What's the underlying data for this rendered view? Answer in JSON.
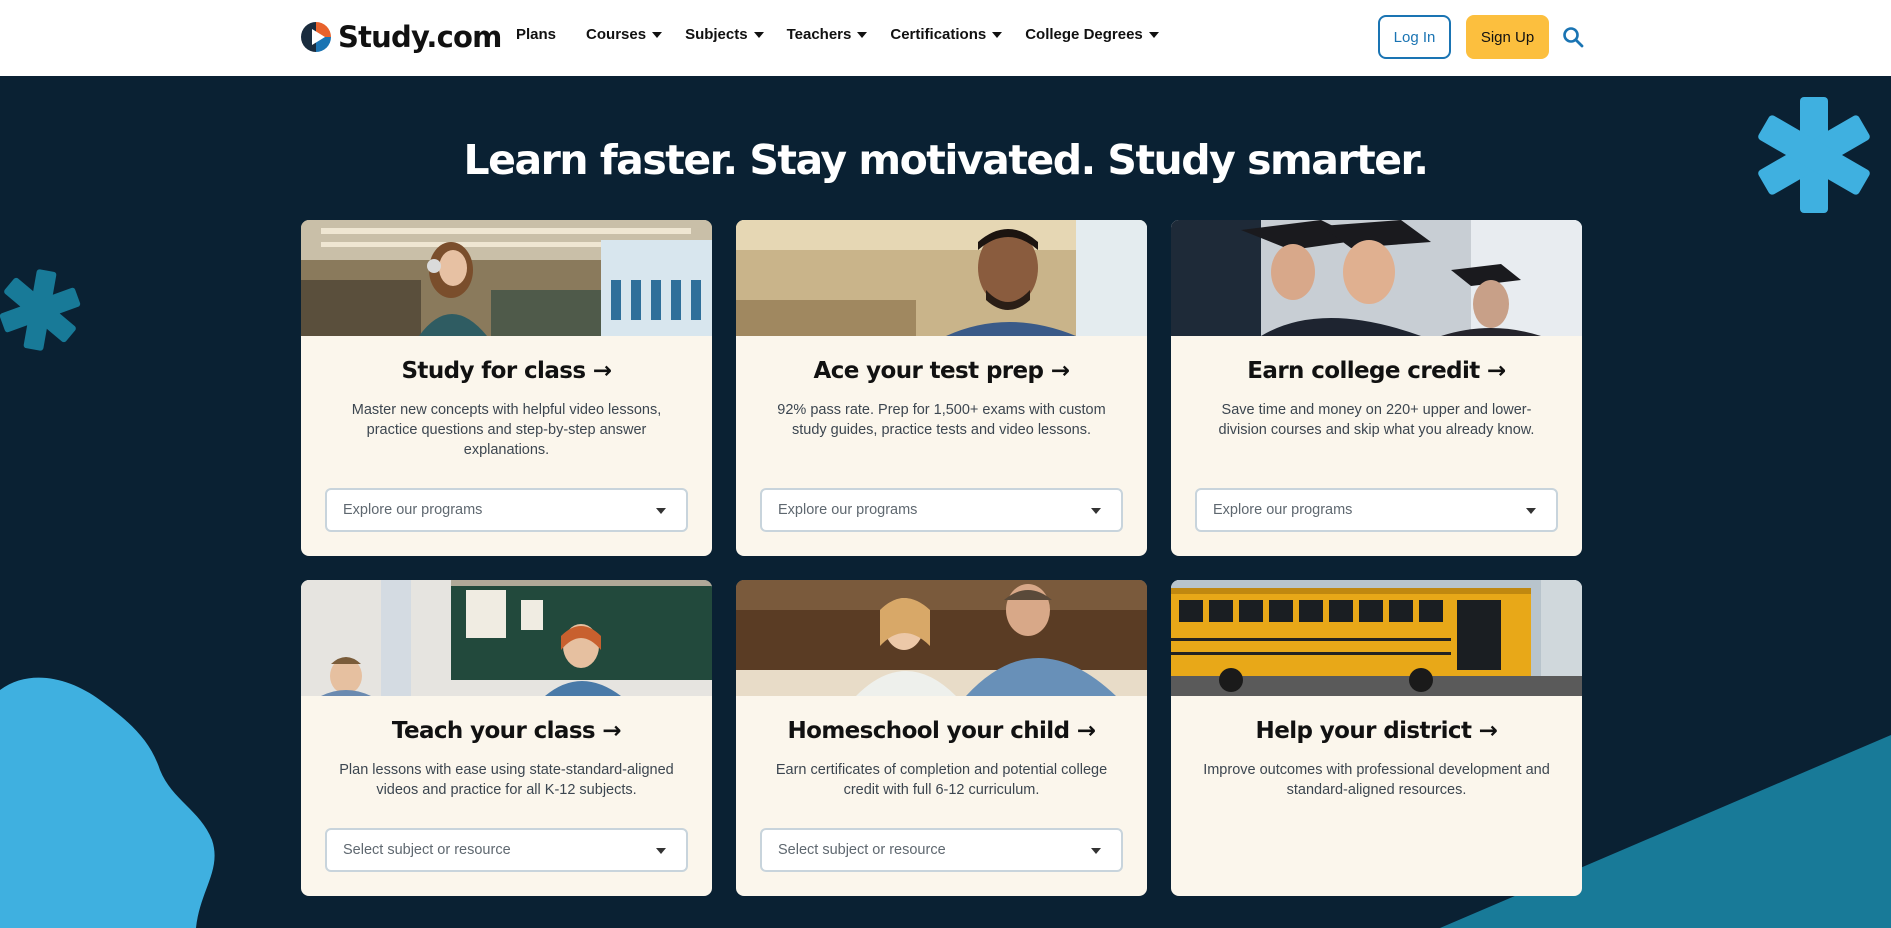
{
  "brand": {
    "name": "Study.com"
  },
  "nav": {
    "items": [
      {
        "label": "Plans",
        "has_dropdown": false
      },
      {
        "label": "Courses",
        "has_dropdown": true
      },
      {
        "label": "Subjects",
        "has_dropdown": true
      },
      {
        "label": "Teachers",
        "has_dropdown": true
      },
      {
        "label": "Certifications",
        "has_dropdown": true
      },
      {
        "label": "College Degrees",
        "has_dropdown": true
      }
    ],
    "login_label": "Log In",
    "signup_label": "Sign Up",
    "search_icon": "search-icon"
  },
  "hero": {
    "headline": "Learn faster. Stay motivated. Study smarter."
  },
  "cards": [
    {
      "title": "Study for class →",
      "description": "Master new concepts with helpful video lessons, practice questions and step-by-step answer explanations.",
      "select_placeholder": "Explore our programs"
    },
    {
      "title": "Ace your test prep →",
      "description": "92% pass rate. Prep for 1,500+ exams with custom study guides, practice tests and video lessons.",
      "select_placeholder": "Explore our programs"
    },
    {
      "title": "Earn college credit →",
      "description": "Save time and money on 220+ upper and lower-division courses and skip what you already know.",
      "select_placeholder": "Explore our programs"
    },
    {
      "title": "Teach your class →",
      "description": "Plan lessons with ease using state-standard-aligned videos and practice for all K-12 subjects.",
      "select_placeholder": "Select subject or resource"
    },
    {
      "title": "Homeschool your child →",
      "description": "Earn certificates of completion and potential college credit with full 6-12 curriculum.",
      "select_placeholder": "Select subject or resource"
    },
    {
      "title": "Help your district →",
      "description": "Improve outcomes with professional development and standard-aligned resources."
    }
  ],
  "colors": {
    "background": "#0a2133",
    "accent_blue": "#1a74b3",
    "signup_yellow": "#fcbf3e",
    "card_bg": "#fbf6ec",
    "deco_light_blue": "#3fb0e0",
    "deco_teal": "#187a98"
  }
}
